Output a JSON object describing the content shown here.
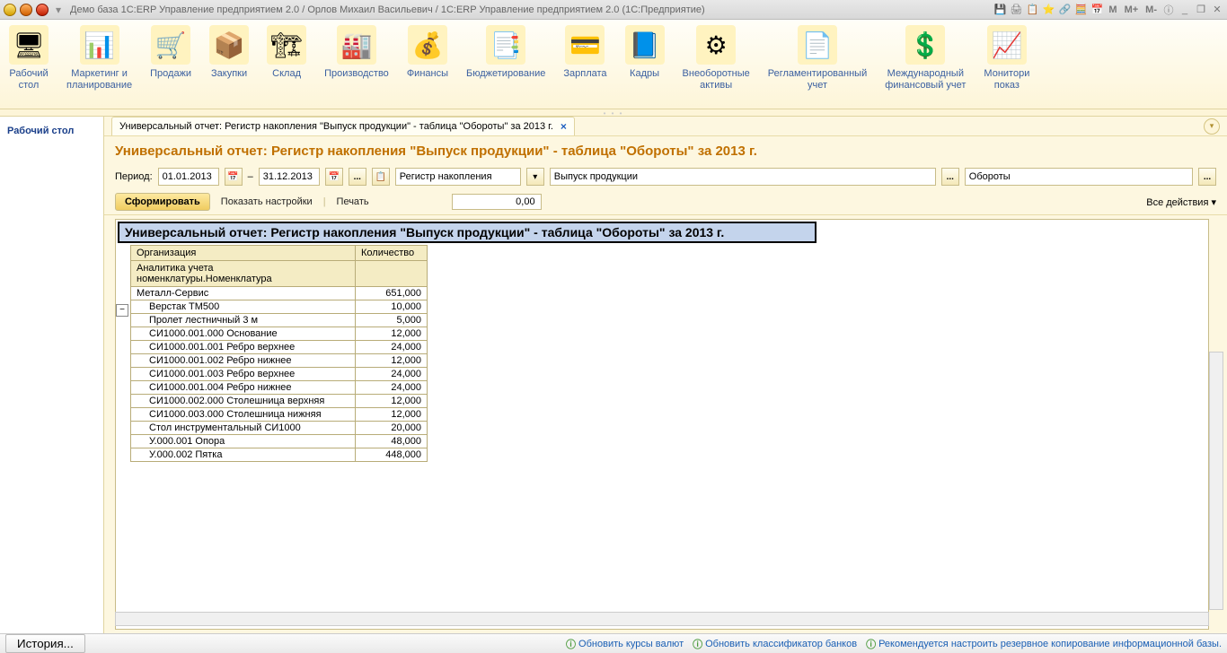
{
  "titlebar": {
    "title": "Демо база 1С:ERP Управление предприятием 2.0 / Орлов Михаил Васильевич / 1C:ERP Управление предприятием 2.0  (1С:Предприятие)",
    "m": "M",
    "mplus": "M+",
    "mminus": "M-"
  },
  "ribbon": [
    {
      "label": "Рабочий\nстол",
      "icon": "🖥"
    },
    {
      "label": "Маркетинг и\nпланирование",
      "icon": "📊"
    },
    {
      "label": "Продажи",
      "icon": "🛒"
    },
    {
      "label": "Закупки",
      "icon": "📦"
    },
    {
      "label": "Склад",
      "icon": "🏗"
    },
    {
      "label": "Производство",
      "icon": "🏭"
    },
    {
      "label": "Финансы",
      "icon": "💰"
    },
    {
      "label": "Бюджетирование",
      "icon": "📑"
    },
    {
      "label": "Зарплата",
      "icon": "💳"
    },
    {
      "label": "Кадры",
      "icon": "📘"
    },
    {
      "label": "Внеоборотные\nактивы",
      "icon": "⚙"
    },
    {
      "label": "Регламентированный\nучет",
      "icon": "📄"
    },
    {
      "label": "Международный\nфинансовый учет",
      "icon": "💲"
    },
    {
      "label": "Монитори\nпоказ",
      "icon": "📈"
    }
  ],
  "sidebar": {
    "desktop": "Рабочий стол"
  },
  "tab": {
    "label": "Универсальный отчет: Регистр накопления \"Выпуск продукции\" - таблица \"Обороты\" за 2013 г."
  },
  "page": {
    "title": "Универсальный отчет: Регистр накопления \"Выпуск продукции\" - таблица \"Обороты\" за 2013 г."
  },
  "filters": {
    "period_label": "Период:",
    "date_from": "01.01.2013",
    "dash": "–",
    "date_to": "31.12.2013",
    "register_type": "Регистр накопления",
    "register_name": "Выпуск продукции",
    "table_name": "Обороты"
  },
  "actions": {
    "generate": "Сформировать",
    "show_settings": "Показать настройки",
    "print": "Печать",
    "num": "0,00",
    "all_actions": "Все действия ▾"
  },
  "report": {
    "title": "Универсальный отчет: Регистр накопления \"Выпуск продукции\" - таблица \"Обороты\" за 2013 г.",
    "col_org": "Организация",
    "col_qty": "Количество",
    "col_sub": "Аналитика учета номенклатуры.Номенклатура",
    "rows": [
      {
        "name": "Металл-Сервис",
        "qty": "651,000",
        "top": true
      },
      {
        "name": "Верстак ТМ500",
        "qty": "10,000"
      },
      {
        "name": "Пролет лестничный 3 м",
        "qty": "5,000"
      },
      {
        "name": "СИ1000.001.000 Основание",
        "qty": "12,000"
      },
      {
        "name": "СИ1000.001.001 Ребро верхнее",
        "qty": "24,000"
      },
      {
        "name": "СИ1000.001.002 Ребро нижнее",
        "qty": "12,000"
      },
      {
        "name": "СИ1000.001.003 Ребро верхнее",
        "qty": "24,000"
      },
      {
        "name": "СИ1000.001.004 Ребро нижнее",
        "qty": "24,000"
      },
      {
        "name": "СИ1000.002.000 Столешница верхняя",
        "qty": "12,000"
      },
      {
        "name": "СИ1000.003.000 Столешница нижняя",
        "qty": "12,000"
      },
      {
        "name": "Стол инструментальный СИ1000",
        "qty": "20,000"
      },
      {
        "name": "У.000.001 Опора",
        "qty": "48,000"
      },
      {
        "name": "У.000.002 Пятка",
        "qty": "448,000"
      }
    ]
  },
  "status": {
    "history": "История...",
    "link1": "Обновить курсы валют",
    "link2": "Обновить классификатор банков",
    "link3": "Рекомендуется настроить резервное копирование информационной базы."
  }
}
